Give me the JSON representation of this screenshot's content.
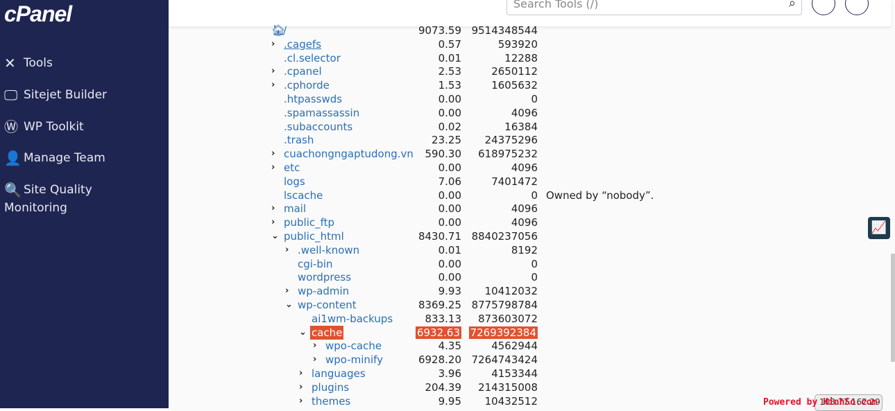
{
  "sidebar": {
    "logo": "cPanel",
    "items": [
      {
        "label": "Tools",
        "icon": "tools-icon",
        "glyph": "✕"
      },
      {
        "label": "Sitejet Builder",
        "icon": "monitor-icon",
        "glyph": "🖵"
      },
      {
        "label": "WP Toolkit",
        "icon": "wordpress-icon",
        "glyph": "Ⓦ"
      },
      {
        "label": "Manage Team",
        "icon": "user-plus-icon",
        "glyph": "👤"
      },
      {
        "label": "Site Quality Monitoring",
        "icon": "magnifier-icon",
        "glyph": "🔍"
      }
    ]
  },
  "header": {
    "search_placeholder": "Search Tools (/)",
    "search_icon": "⌕",
    "bell": "🔔",
    "user": "👤"
  },
  "tree": [
    {
      "name": "/",
      "level": 0,
      "chev": "",
      "home": true,
      "mb": "9073.59",
      "bytes": "9514348544"
    },
    {
      "name": ".cagefs",
      "level": 0,
      "chev": "›",
      "mb": "0.57",
      "bytes": "593920",
      "underline": true
    },
    {
      "name": ".cl.selector",
      "level": 0,
      "chev": "",
      "mb": "0.01",
      "bytes": "12288"
    },
    {
      "name": ".cpanel",
      "level": 0,
      "chev": "›",
      "mb": "2.53",
      "bytes": "2650112"
    },
    {
      "name": ".cphorde",
      "level": 0,
      "chev": "›",
      "mb": "1.53",
      "bytes": "1605632"
    },
    {
      "name": ".htpasswds",
      "level": 0,
      "chev": "",
      "mb": "0.00",
      "bytes": "0"
    },
    {
      "name": ".spamassassin",
      "level": 0,
      "chev": "",
      "mb": "0.00",
      "bytes": "4096"
    },
    {
      "name": ".subaccounts",
      "level": 0,
      "chev": "",
      "mb": "0.02",
      "bytes": "16384"
    },
    {
      "name": ".trash",
      "level": 0,
      "chev": "",
      "mb": "23.25",
      "bytes": "24375296"
    },
    {
      "name": "cuachongngaptudong.vn",
      "level": 0,
      "chev": "›",
      "mb": "590.30",
      "bytes": "618975232"
    },
    {
      "name": "etc",
      "level": 0,
      "chev": "›",
      "mb": "0.00",
      "bytes": "4096"
    },
    {
      "name": "logs",
      "level": 0,
      "chev": "",
      "mb": "7.06",
      "bytes": "7401472"
    },
    {
      "name": "lscache",
      "level": 0,
      "chev": "",
      "mb": "0.00",
      "bytes": "0",
      "note": "Owned by “nobody”."
    },
    {
      "name": "mail",
      "level": 0,
      "chev": "›",
      "mb": "0.00",
      "bytes": "4096"
    },
    {
      "name": "public_ftp",
      "level": 0,
      "chev": "›",
      "mb": "0.00",
      "bytes": "4096"
    },
    {
      "name": "public_html",
      "level": 0,
      "chev": "⌄",
      "mb": "8430.71",
      "bytes": "8840237056"
    },
    {
      "name": ".well-known",
      "level": 1,
      "chev": "›",
      "mb": "0.01",
      "bytes": "8192"
    },
    {
      "name": "cgi-bin",
      "level": 1,
      "chev": "",
      "mb": "0.00",
      "bytes": "0"
    },
    {
      "name": "wordpress",
      "level": 1,
      "chev": "",
      "mb": "0.00",
      "bytes": "0"
    },
    {
      "name": "wp-admin",
      "level": 1,
      "chev": "›",
      "mb": "9.93",
      "bytes": "10412032"
    },
    {
      "name": "wp-content",
      "level": 1,
      "chev": "⌄",
      "mb": "8369.25",
      "bytes": "8775798784"
    },
    {
      "name": "ai1wm-backups",
      "level": 2,
      "chev": "",
      "mb": "833.13",
      "bytes": "873603072"
    },
    {
      "name": "cache",
      "level": 2,
      "chev": "⌄",
      "mb": "6932.63",
      "bytes": "7269392384",
      "highlight": true
    },
    {
      "name": "wpo-cache",
      "level": 3,
      "chev": "›",
      "mb": "4.35",
      "bytes": "4562944"
    },
    {
      "name": "wpo-minify",
      "level": 3,
      "chev": "›",
      "mb": "6928.20",
      "bytes": "7264743424"
    },
    {
      "name": "languages",
      "level": 2,
      "chev": "›",
      "mb": "3.96",
      "bytes": "4153344"
    },
    {
      "name": "plugins",
      "level": 2,
      "chev": "›",
      "mb": "204.39",
      "bytes": "214315008"
    },
    {
      "name": "themes",
      "level": 2,
      "chev": "›",
      "mb": "9.95",
      "bytes": "10432512"
    }
  ],
  "highlight_color": "#e0522f",
  "ip": "103.77.162.29",
  "watermark": "Powered by HinhSo.com"
}
